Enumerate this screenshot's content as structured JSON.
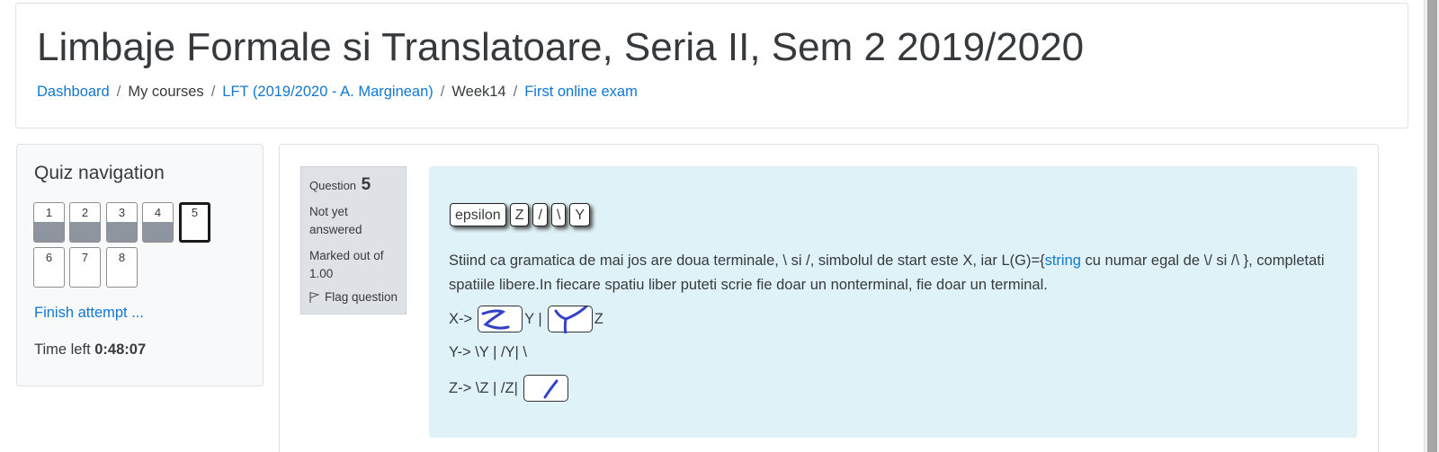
{
  "page": {
    "title": "Limbaje Formale si Translatoare, Seria II, Sem 2 2019/2020"
  },
  "breadcrumb": {
    "items": [
      {
        "label": "Dashboard",
        "link": true
      },
      {
        "label": "My courses",
        "link": false
      },
      {
        "label": "LFT (2019/2020 - A. Marginean)",
        "link": true
      },
      {
        "label": "Week14",
        "link": false
      },
      {
        "label": "First online exam",
        "link": true
      }
    ],
    "separator": "/"
  },
  "quiz_nav": {
    "title": "Quiz navigation",
    "questions": [
      {
        "number": "1",
        "answered": true,
        "current": false
      },
      {
        "number": "2",
        "answered": true,
        "current": false
      },
      {
        "number": "3",
        "answered": true,
        "current": false
      },
      {
        "number": "4",
        "answered": true,
        "current": false
      },
      {
        "number": "5",
        "answered": false,
        "current": true
      },
      {
        "number": "6",
        "answered": false,
        "current": false
      },
      {
        "number": "7",
        "answered": false,
        "current": false
      },
      {
        "number": "8",
        "answered": false,
        "current": false
      }
    ],
    "finish_label": "Finish attempt ...",
    "time_left_label": "Time left",
    "time_left_value": "0:48:07"
  },
  "question_info": {
    "label": "Question",
    "number": "5",
    "state": "Not yet answered",
    "grade": "Marked out of 1.00",
    "flag_label": "Flag question"
  },
  "question": {
    "drag_items": [
      "epsilon",
      "Z",
      "/",
      "\\",
      "Y"
    ],
    "text_before": "Stiind ca gramatica de mai jos are doua terminale, \\ si /, simbolul de start este X, iar L(G)={",
    "text_highlight": "string",
    "text_after": " cu numar egal de \\/ si /\\ }, completati spatiile libere.In fiecare spatiu liber puteti scrie fie doar un nonterminal, fie doar un terminal.",
    "rule_x": {
      "prefix": "X->",
      "middle": "Y |",
      "suffix": "Z"
    },
    "rule_y": {
      "text": "Y-> \\Y | /Y| \\"
    },
    "rule_z": {
      "prefix": "Z-> \\Z | /Z|"
    },
    "handwritten_answers": [
      "Z",
      "Y",
      "/"
    ],
    "handwriting_color": "#3340c8",
    "accent_color": "#1177d1",
    "box_color": "#def2f8"
  }
}
